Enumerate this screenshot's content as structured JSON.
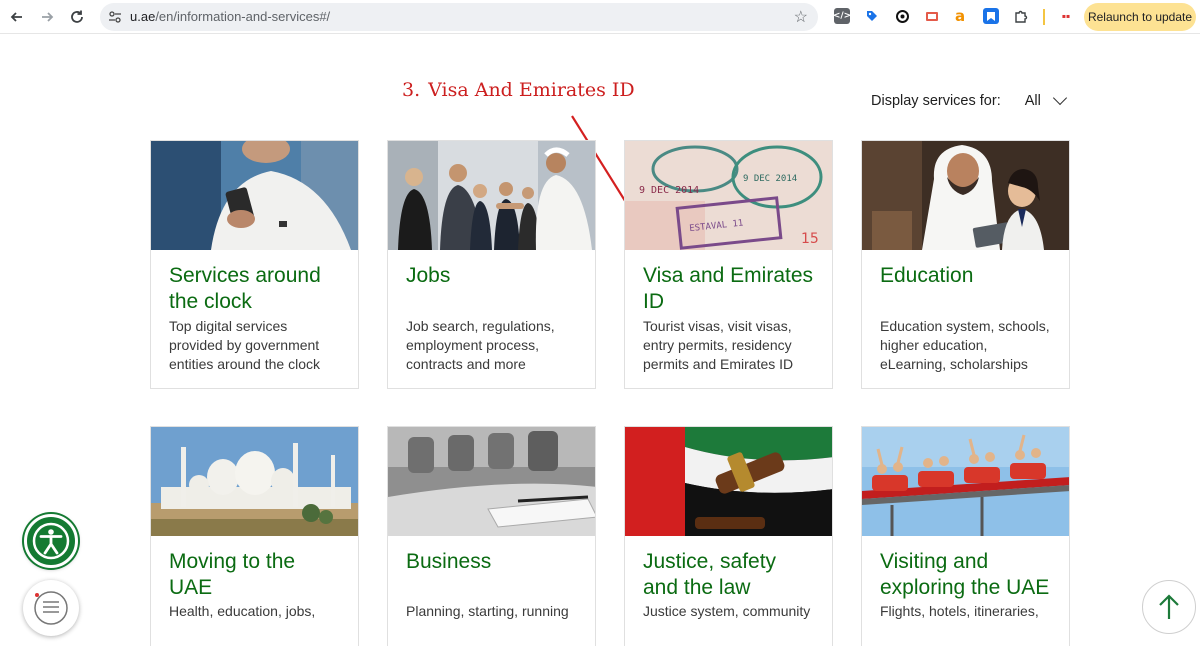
{
  "browser": {
    "url_host": "u.ae",
    "url_path": "/en/information-and-services#/",
    "relaunch_label": "Relaunch to update",
    "extensions": [
      "code-ext-icon",
      "tag-ext-icon",
      "chatgpt-ext-icon",
      "screenshot-ext-icon",
      "amazon-ext-icon",
      "bookmark-ext-icon",
      "puzzle-icon",
      "toolbar-ext-icon"
    ]
  },
  "annotation": {
    "number": "3.",
    "text": "Visa And Emirates ID",
    "color": "#cc1f1f"
  },
  "filter": {
    "label": "Display services for:",
    "value": "All"
  },
  "cards": [
    {
      "title": "Services around the clock",
      "desc": "Top digital services provided by government entities around the clock",
      "image": "person-using-phone"
    },
    {
      "title": "Jobs",
      "desc": "Job search, regulations, employment process, contracts and more",
      "image": "business-handshake"
    },
    {
      "title": "Visa and Emirates ID",
      "desc": "Tourist visas, visit visas, entry permits, residency permits and Emirates ID",
      "image": "passport-stamps"
    },
    {
      "title": "Education",
      "desc": "Education system, schools, higher education, eLearning, scholarships",
      "image": "man-and-child-with-tablet"
    },
    {
      "title": "Moving to the UAE",
      "desc": "Health, education, jobs,",
      "image": "grand-mosque"
    },
    {
      "title": "Business",
      "desc": "Planning, starting, running",
      "image": "meeting-table-notebook"
    },
    {
      "title": "Justice, safety and the law",
      "desc": "Justice system, community",
      "image": "gavel-and-uae-flag"
    },
    {
      "title": "Visiting and exploring the UAE",
      "desc": "Flights, hotels, itineraries,",
      "image": "roller-coaster"
    }
  ],
  "colors": {
    "title_green": "#0b6b12",
    "accessibility_green": "#147a32"
  }
}
